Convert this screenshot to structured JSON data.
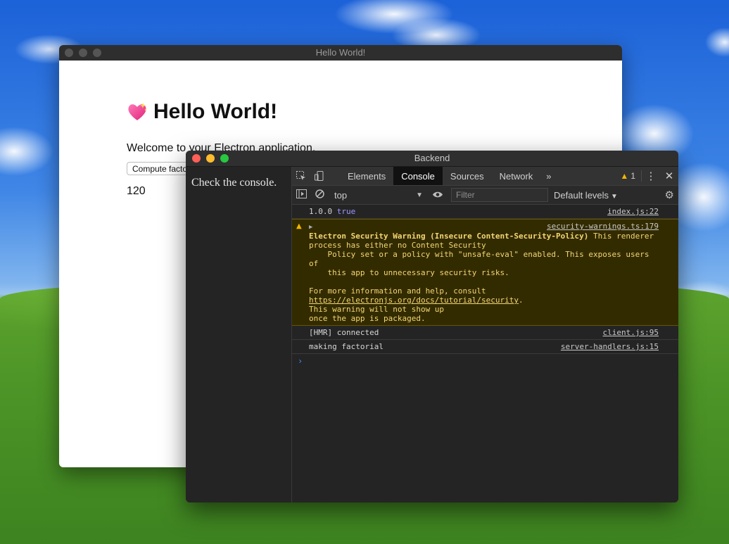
{
  "main_window": {
    "title": "Hello World!",
    "heading": "Hello World!",
    "emoji": "sparkling-heart",
    "welcome": "Welcome to your Electron application.",
    "button_label": "Compute factorial",
    "result": "120"
  },
  "devtools_window": {
    "title": "Backend",
    "left_text": "Check the console.",
    "tabs": [
      "Elements",
      "Console",
      "Sources",
      "Network"
    ],
    "active_tab": "Console",
    "more_tabs": "»",
    "warning_count": "1",
    "context": "top",
    "filter_placeholder": "Filter",
    "levels": "Default levels"
  },
  "console": {
    "row1": {
      "text": "1.0.0",
      "bool": "true",
      "source": "index.js:22"
    },
    "warning": {
      "source": "security-warnings.ts:179",
      "bold": "Electron Security Warning (Insecure Content-Security-Policy)",
      "line1_rest": " This renderer",
      "line2": "process has either no Content Security",
      "line3": "    Policy set or a policy with \"unsafe-eval\" enabled. This exposes users",
      "line4": "of",
      "line5": "    this app to unnecessary security risks.",
      "line6": "For more information and help, consult",
      "link": "https://electronjs.org/docs/tutorial/security",
      "link_after": ".",
      "line8": "This warning will not show up",
      "line9": "once the app is packaged."
    },
    "row3": {
      "text": "[HMR] connected",
      "source": "client.js:95"
    },
    "row4": {
      "text": "making factorial",
      "source": "server-handlers.js:15"
    },
    "prompt": "›"
  },
  "colors": {
    "warning_bg": "#332b00",
    "warning_text": "#f3d675",
    "active_tab_bg": "#111111",
    "bool_color": "#9b97ff"
  }
}
